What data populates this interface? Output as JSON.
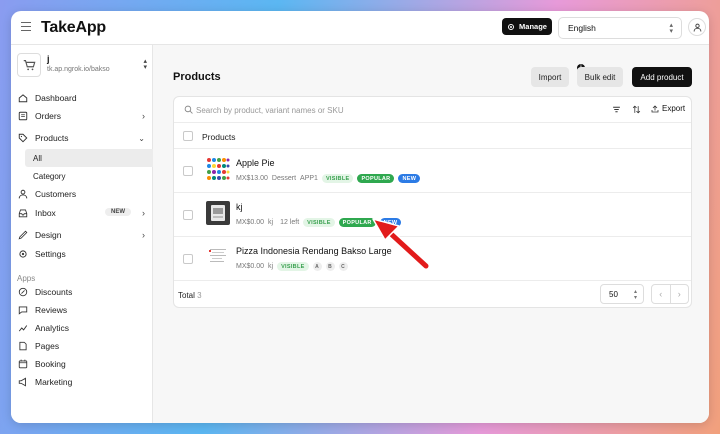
{
  "header": {
    "brand": "TakeApp",
    "manage_label": "Manage",
    "language": "English"
  },
  "sidebar": {
    "store_name": "j",
    "store_url": "tk.ap.ngrok.io/bakso",
    "items": [
      {
        "label": "Dashboard",
        "icon": "home-icon"
      },
      {
        "label": "Orders",
        "icon": "orders-icon"
      },
      {
        "label": "Products",
        "icon": "tag-icon"
      },
      {
        "label": "All"
      },
      {
        "label": "Category"
      },
      {
        "label": "Customers",
        "icon": "user-icon"
      },
      {
        "label": "Inbox",
        "icon": "inbox-icon",
        "badge": "NEW"
      },
      {
        "label": "Design",
        "icon": "design-icon"
      },
      {
        "label": "Settings",
        "icon": "gear-icon"
      }
    ],
    "apps_label": "Apps",
    "apps": [
      {
        "label": "Discounts",
        "icon": "discount-icon"
      },
      {
        "label": "Reviews",
        "icon": "review-icon"
      },
      {
        "label": "Analytics",
        "icon": "analytics-icon"
      },
      {
        "label": "Pages",
        "icon": "page-icon"
      },
      {
        "label": "Booking",
        "icon": "calendar-icon"
      },
      {
        "label": "Marketing",
        "icon": "megaphone-icon"
      }
    ]
  },
  "main": {
    "title": "Products",
    "import_label": "Import",
    "info_badge": "i",
    "bulk_edit_label": "Bulk edit",
    "add_product_label": "Add product",
    "search_placeholder": "Search by product, variant names or SKU",
    "export_label": "Export",
    "column_header": "Products",
    "products": [
      {
        "name": "Apple Pie",
        "price": "MX$13.00",
        "category": "Dessert",
        "extra": "APP1",
        "tags": [
          "VISIBLE",
          "POPULAR",
          "NEW"
        ]
      },
      {
        "name": "kj",
        "price": "MX$0.00",
        "category": "kj",
        "extra": "12 left",
        "tags": [
          "VISIBLE",
          "POPULAR",
          "NEW"
        ]
      },
      {
        "name": "Pizza Indonesia Rendang Bakso Large",
        "price": "MX$0.00",
        "category": "kj",
        "tags": [
          "VISIBLE"
        ],
        "mini_tags": [
          "A",
          "B",
          "C"
        ]
      }
    ],
    "total_label": "Total",
    "total_value": "3",
    "per_page": "50",
    "pager_prev": "‹",
    "pager_next": "›"
  },
  "colors": {
    "accent": "#111111",
    "visible_tag": "#38a04e",
    "popular_tag": "#2fa84f",
    "new_tag": "#2c7be5",
    "annotation_arrow": "#e21b1b"
  }
}
